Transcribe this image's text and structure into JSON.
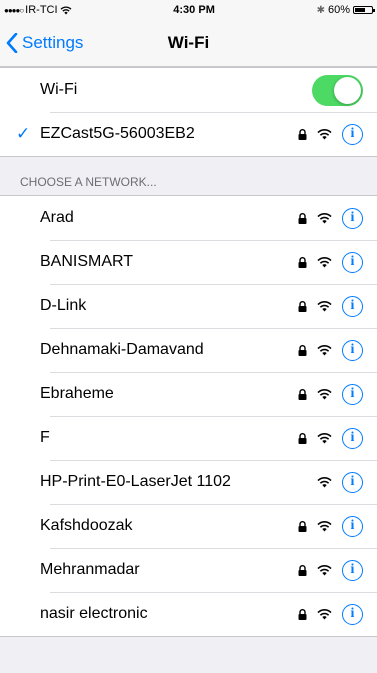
{
  "status_bar": {
    "carrier": "IR-TCI",
    "time": "4:30 PM",
    "battery": "60%",
    "battery_level": 0.6
  },
  "nav": {
    "back_label": "Settings",
    "title": "Wi-Fi"
  },
  "wifi_toggle": {
    "label": "Wi-Fi",
    "on": true,
    "color": "#4cd964"
  },
  "connected": {
    "name": "EZCast5G-56003EB2",
    "locked": true
  },
  "section_header": "CHOOSE A NETWORK...",
  "networks": [
    {
      "name": "Arad",
      "locked": true
    },
    {
      "name": "BANISMART",
      "locked": true
    },
    {
      "name": "D-Link",
      "locked": true
    },
    {
      "name": "Dehnamaki-Damavand",
      "locked": true
    },
    {
      "name": "Ebraheme",
      "locked": true
    },
    {
      "name": "F",
      "locked": true
    },
    {
      "name": "HP-Print-E0-LaserJet 1102",
      "locked": false
    },
    {
      "name": "Kafshdoozak",
      "locked": true
    },
    {
      "name": "Mehranmadar",
      "locked": true
    },
    {
      "name": "nasir electronic",
      "locked": true
    }
  ],
  "accent_color": "#007aff"
}
